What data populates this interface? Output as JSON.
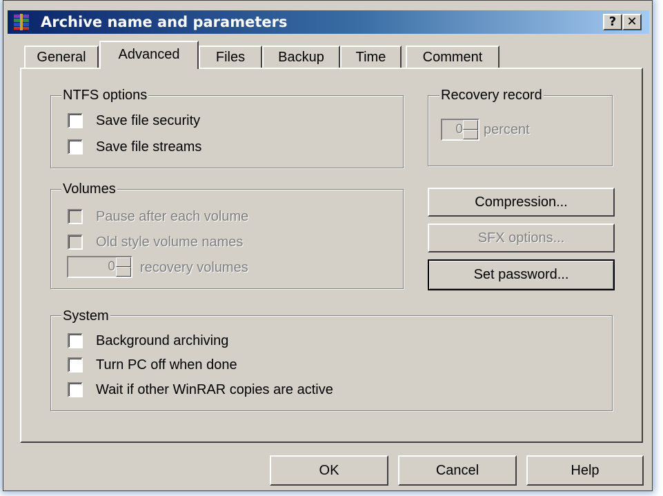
{
  "window": {
    "title": "Archive name and parameters",
    "help_glyph": "?",
    "close_glyph": "✕"
  },
  "tabs": [
    {
      "label": "General",
      "active": false
    },
    {
      "label": "Advanced",
      "active": true
    },
    {
      "label": "Files",
      "active": false
    },
    {
      "label": "Backup",
      "active": false
    },
    {
      "label": "Time",
      "active": false
    },
    {
      "label": "Comment",
      "active": false
    }
  ],
  "ntfs": {
    "title": "NTFS options",
    "options": [
      {
        "label": "Save file security",
        "checked": false
      },
      {
        "label": "Save file streams",
        "checked": false
      }
    ]
  },
  "recovery": {
    "title": "Recovery record",
    "value": "0",
    "unit": "percent",
    "enabled": false
  },
  "volumes": {
    "title": "Volumes",
    "options": [
      {
        "label": "Pause after each volume",
        "checked": false,
        "enabled": false
      },
      {
        "label": "Old style volume names",
        "checked": false,
        "enabled": false
      }
    ],
    "recovery_value": "0",
    "recovery_label": "recovery volumes"
  },
  "side_buttons": {
    "compression": "Compression...",
    "sfx": "SFX options...",
    "password": "Set password..."
  },
  "system": {
    "title": "System",
    "options": [
      {
        "label": "Background archiving",
        "checked": false
      },
      {
        "label": "Turn PC off when done",
        "checked": false
      },
      {
        "label": "Wait if other WinRAR copies are active",
        "checked": false
      }
    ]
  },
  "footer": {
    "ok": "OK",
    "cancel": "Cancel",
    "help": "Help"
  },
  "colors": {
    "face": "#d4d0c8",
    "title_start": "#0a246a",
    "title_end": "#a6caf0",
    "disabled_text": "#808080"
  }
}
